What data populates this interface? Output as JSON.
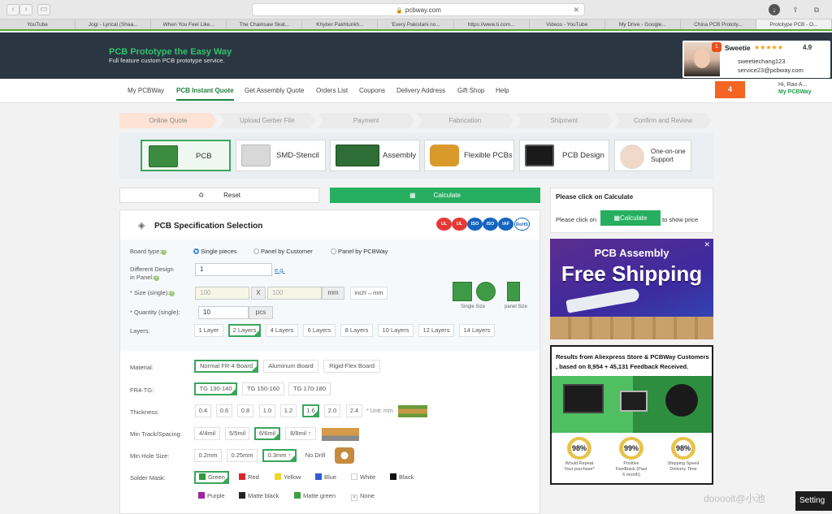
{
  "browser": {
    "url": "pcbway.com",
    "tabs": [
      "YouTube",
      "Jogi - Lyrical (Shaa...",
      "When You Feel Like...",
      "The Chainsaw Skat...",
      "Khyber Pakhtunkh...",
      "'Every Pakistani no...",
      "https://www.ti.com...",
      "Videos - YouTube",
      "My Drive - Google...",
      "China PCB Prototy...",
      "Prototype PCB - O..."
    ]
  },
  "header": {
    "title": "PCB Prototype the Easy Way",
    "subtitle": "Full feature custom PCB prototype service.",
    "agent": {
      "name": "Sweetie",
      "stars": "★★★★★",
      "rating": "4.9",
      "username": "sweetiechang123",
      "email": "service23@pcbway.com",
      "badge": "1"
    }
  },
  "nav": {
    "items": [
      "My PCBWay",
      "PCB Instant Quote",
      "Get Assembly Quote",
      "Orders List",
      "Coupons",
      "Delivery Address",
      "Gift Shop",
      "Help"
    ],
    "cart_count": "4",
    "greeting": "Hi, Rao A...",
    "account": "My PCBWay"
  },
  "steps": [
    "Online Quote",
    "Upload Gerber File",
    "Payment",
    "Fabrication",
    "Shipment",
    "Confirm and Review"
  ],
  "services": [
    "PCB",
    "SMD-Stencil",
    "Assembly",
    "Flexible PCBs",
    "PCB Design",
    "One-on-one Support"
  ],
  "actions": {
    "reset": "Reset",
    "calculate": "Calculate"
  },
  "spec": {
    "title": "PCB Specification Selection",
    "certs": [
      "UL",
      "UL",
      "ISO",
      "ISO",
      "IAF",
      "RoHS"
    ],
    "board_type": {
      "label": "Board type:",
      "options": [
        "Single pieces",
        "Panel by Customer",
        "Panel by PCBWay"
      ],
      "selected": "Single pieces"
    },
    "different_design": {
      "label1": "Different Design",
      "label2": "in Panel:",
      "value": "1",
      "eg": "e.g."
    },
    "size": {
      "label": "* Size (single):",
      "w": "100",
      "x": "X",
      "h": "100",
      "unit": "mm",
      "convert": "inch'↔mm",
      "single_size": "Single Size",
      "panel_size": "panel Size"
    },
    "quantity": {
      "label": "* Quantity (single):",
      "value": "10",
      "unit": "pcs"
    },
    "layers": {
      "label": "Layers:",
      "options": [
        "1 Layer",
        "2 Layers",
        "4 Layers",
        "6 Layers",
        "8 Layers",
        "10 Layers",
        "12 Layers",
        "14 Layers"
      ]
    },
    "material": {
      "label": "Material:",
      "options": [
        "Normal FR-4 Board",
        "Aluminum Board",
        "Rigid-Flex Board"
      ]
    },
    "fr4tg": {
      "label": "FR4-TG:",
      "options": [
        "TG 130-140",
        "TG 150-160",
        "TG 170-180"
      ]
    },
    "thickness": {
      "label": "Thickness:",
      "options": [
        "0.4",
        "0.6",
        "0.8",
        "1.0",
        "1.2",
        "1.6",
        "2.0",
        "2.4"
      ],
      "unit": "* Unit: mm"
    },
    "track": {
      "label": "Min Track/Spacing:",
      "options": [
        "4/4mil",
        "5/5mil",
        "6/6mil",
        "8/8mil ↑"
      ]
    },
    "hole": {
      "label": "Min Hole Size:",
      "options": [
        "0.2mm",
        "0.25mm",
        "0.3mm ↑",
        "No Drill"
      ]
    },
    "solder": {
      "label": "Solder Mask:",
      "options": [
        "Green",
        "Red",
        "Yellow",
        "Blue",
        "White",
        "Black",
        "Purple",
        "Matte black",
        "Matte green",
        "None"
      ],
      "colors": [
        "#2e9b3e",
        "#d9262b",
        "#e8d92a",
        "#2f5bd0",
        "#ffffff",
        "#111111",
        "#a3239b",
        "#222222",
        "#3f9e46",
        "#ffffff"
      ]
    }
  },
  "side": {
    "title": "Please click on Calculate",
    "text1": "Please click on",
    "button": "Calculate",
    "text2": "to show price"
  },
  "ad1": {
    "line1": "PCB Assembly",
    "line2": "Free Shipping"
  },
  "ad2": {
    "header": "Results from Aliexpress Store & PCBWay Customers , based on 8,954 + 45,131 Feedback Received.",
    "stats": [
      {
        "value": "98%",
        "caption": "Would Repeat Your purchase*"
      },
      {
        "value": "99%",
        "caption": "Positive Feedback (Past 6 month)"
      },
      {
        "value": "98%",
        "caption": "Shipping Speed Delivery Time"
      }
    ]
  },
  "overlay": {
    "watermark": "dooooit@小池",
    "settings": "Setting"
  }
}
